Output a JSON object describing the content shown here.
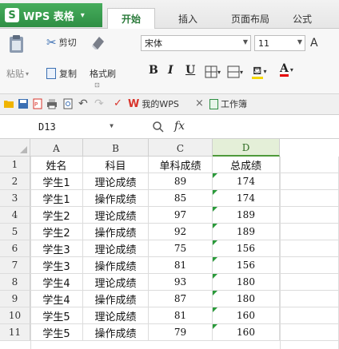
{
  "app": {
    "name": "WPS 表格"
  },
  "ribbon_tabs": [
    {
      "label": "开始",
      "active": true
    },
    {
      "label": "插入",
      "active": false
    },
    {
      "label": "页面布局",
      "active": false
    },
    {
      "label": "公式",
      "active": false
    }
  ],
  "ribbon": {
    "cut": "剪切",
    "copy": "复制",
    "format_painter": "格式刷",
    "paste": "粘贴",
    "font_name": "宋体",
    "font_size": "11",
    "bold": "B",
    "italic": "I",
    "underline": "U",
    "font_color_letter": "A"
  },
  "quickbar": {
    "my_wps": "我的WPS",
    "close": "×",
    "workbook": "工作簿"
  },
  "formula_bar": {
    "name_box": "D13",
    "fx": "fx"
  },
  "columns": [
    {
      "label": "A",
      "selected": false
    },
    {
      "label": "B",
      "selected": false
    },
    {
      "label": "C",
      "selected": false
    },
    {
      "label": "D",
      "selected": true
    }
  ],
  "rows": [
    {
      "n": "1",
      "cells": [
        "姓名",
        "科目",
        "单科成绩",
        "总成绩"
      ]
    },
    {
      "n": "2",
      "cells": [
        "学生1",
        "理论成绩",
        "89",
        "174"
      ]
    },
    {
      "n": "3",
      "cells": [
        "学生1",
        "操作成绩",
        "85",
        "174"
      ]
    },
    {
      "n": "4",
      "cells": [
        "学生2",
        "理论成绩",
        "97",
        "189"
      ]
    },
    {
      "n": "5",
      "cells": [
        "学生2",
        "操作成绩",
        "92",
        "189"
      ]
    },
    {
      "n": "6",
      "cells": [
        "学生3",
        "理论成绩",
        "75",
        "156"
      ]
    },
    {
      "n": "7",
      "cells": [
        "学生3",
        "操作成绩",
        "81",
        "156"
      ]
    },
    {
      "n": "8",
      "cells": [
        "学生4",
        "理论成绩",
        "93",
        "180"
      ]
    },
    {
      "n": "9",
      "cells": [
        "学生4",
        "操作成绩",
        "87",
        "180"
      ]
    },
    {
      "n": "10",
      "cells": [
        "学生5",
        "理论成绩",
        "81",
        "160"
      ]
    },
    {
      "n": "11",
      "cells": [
        "学生5",
        "操作成绩",
        "79",
        "160"
      ]
    }
  ],
  "colors": {
    "accent_green": "#2f8f44",
    "selected_col": "#e4efd8",
    "error_flag": "#2a9a3a"
  }
}
